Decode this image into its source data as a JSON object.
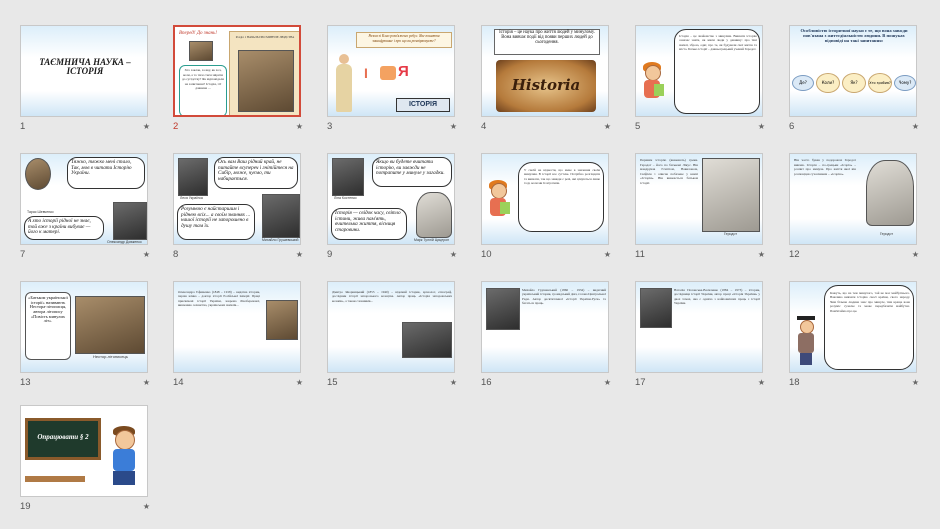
{
  "slides": [
    {
      "number": "1",
      "title": "ТАЄМНИЧА НАУКА – ІСТОРІЯ"
    },
    {
      "number": "2",
      "label1": "Вперед! До знань!",
      "label2": "Розділ 1 НАЧАЛЬ ПРО МИНУЛЕ ЛЮДСТВА",
      "text": "Хто заклав, за яку, як хоч, коли, а то тичо тися звіряти до сусідству? Як відповідали на запитання? Історія, і її давнина ..."
    },
    {
      "number": "3",
      "question": "Разом зі Клио розв'яжемо ребус. Яке поняття зашифроване і про що ви розмірковуєте?",
      "word": "ІСТОРІЯ",
      "rebus": "Я"
    },
    {
      "number": "4",
      "text": "Історія – це наука про життя людей у минулому. Вона вивчає події від появи перших людей до сьогодення.",
      "word": "Historia"
    },
    {
      "number": "5",
      "text": "Історія – це знайомство з минулим. Вивчати історію означає знати, як жили люди у давнину: про їхні звичаї, зброю, одяг, про те, як будували свої житла та місто. Батько історії – давньогрецький учений Геродот."
    },
    {
      "number": "6",
      "title": "Особливістю історичної науки є те, що вона завжди пов'язана з життєдіяльністю людини. В пошуках відповіді на такі запитання:",
      "bubbles": [
        "Де?",
        "Коли?",
        "Як?",
        "Хто зробив?",
        "Чому?"
      ]
    },
    {
      "number": "7",
      "quote": "Тяжко, тяжко мені стало, Так, мов в читати Історію України.",
      "quote2": "А хто історії рідної не знає, той вже з країни вибуває — його к матері.",
      "cap1": "Тарас Шевченко",
      "cap2": "Олександр Довженко"
    },
    {
      "number": "8",
      "quote": "Ось вам Ваш рідний край, не питайте всупереч і гнітійтеся на Сибір, може, чуємо, ти набирається.",
      "quote2": "Розумною є найстаршим і ріднею всіх... а своїм знаннях ... нашої історії не запорошено в душу там їх.",
      "cap1": "Леся Українка",
      "cap2": "Михайло Грушевський"
    },
    {
      "number": "9",
      "quote": "Якщо ви будете вчитати історію, ви завжди не потрапите у минуле у загадки.",
      "quote2": "Історія — свідок часу, світло істини, жива пам'ять, вчителька життя, вісниця старовини.",
      "cap1": "Ліна Костенко",
      "cap2": "Марк Туллій Цицерон"
    },
    {
      "number": "10",
      "text": "У своїй не віднести, що мене в значення своїм минулим. В історії все суттєве. Потрібно розглядати та вивчати, так що завжди є речі, які цінуються лише тоді, коли ми їх втратили."
    },
    {
      "number": "11",
      "text": "Першим історію (вважають) греки. Геродот – його по батькові Лікус. Він мандрував Єгиптом, Вавилоном, Скіфією і описав побачене у книзі «Історія». Він вважається батьком історії.",
      "cap": "Геродот"
    },
    {
      "number": "12",
      "text": "Він часто бував у подорожах Геродот вивчав. Історія – по-грецьки «Ісоріа» – розпит про минуле. Про життя якої він розповідав сучасникам – «ісорію».",
      "cap": "Геродот"
    },
    {
      "number": "13",
      "text": "«Батьком української історії» називають Нестора-літописця, автора літопису «Повість минулих літ».",
      "cap": "Нестор-літописець"
    },
    {
      "number": "14",
      "text": "Олександра Єфименко (1848 – 1918) – видатна історик, перша жінка – доктор історії Російської імперії. Праці присвячені історії України, зокрема Лівобережної, вивченню селянства, українських звичаїв..."
    },
    {
      "number": "15",
      "text": "Дмитро Яворницький (1855 – 1940) – відомий історик, археолог, етнограф, дослідник історії запорозького козацтва. Автор праць «Історія запорожських козаків», а також словників..."
    },
    {
      "number": "16",
      "text": "Михайло Грушевський (1866 – 1934) – видатний український історик, громадський діяч, голова Центральної Ради. Автор десятитомної «Історії України-Руси» та багатьох праць."
    },
    {
      "number": "17",
      "text": "Наталія Полонська-Василенко (1884 – 1973) – історик, дослідниця історії України, автор праці «Історія України» у двох томах, яка є однією з найповніших праць з історії України."
    },
    {
      "number": "18",
      "text": "Кажуть, що на теж минулого, той не має майбутнього. Важливо вивчати історію своєї країни, свого народу. Чим більше людина знає про минуле, тим краще вона розуміє сучасне та може передбачити майбутнє. Пам'ятаймо про це."
    },
    {
      "number": "19",
      "text": "Опрацювати § 2"
    }
  ],
  "colors": {
    "selected": "#d24a3a",
    "accent": "#1d3557"
  }
}
